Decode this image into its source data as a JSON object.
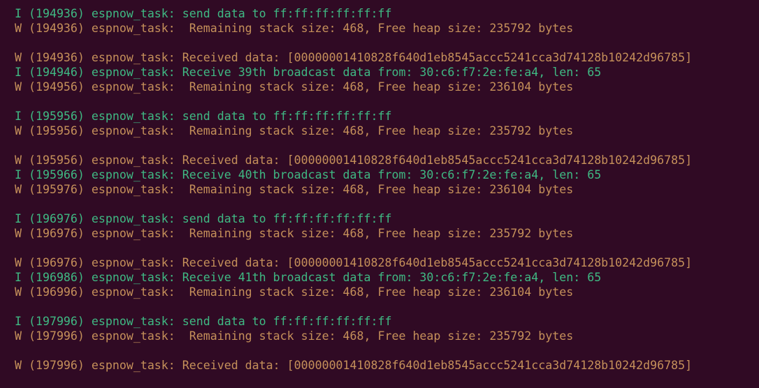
{
  "colors": {
    "background": "#300a24",
    "info": "#3fb983",
    "warning": "#c5905a"
  },
  "terminal": {
    "lines": [
      {
        "level": "I",
        "text": "I (194936) espnow_task: send data to ff:ff:ff:ff:ff:ff"
      },
      {
        "level": "W",
        "text": "W (194936) espnow_task:  Remaining stack size: 468, Free heap size: 235792 bytes"
      },
      {
        "level": "blank",
        "text": ""
      },
      {
        "level": "W",
        "text": "W (194936) espnow_task: Received data: [00000001410828f640d1eb8545accc5241cca3d74128b10242d96785]"
      },
      {
        "level": "I",
        "text": "I (194946) espnow_task: Receive 39th broadcast data from: 30:c6:f7:2e:fe:a4, len: 65"
      },
      {
        "level": "W",
        "text": "W (194956) espnow_task:  Remaining stack size: 468, Free heap size: 236104 bytes"
      },
      {
        "level": "blank",
        "text": ""
      },
      {
        "level": "I",
        "text": "I (195956) espnow_task: send data to ff:ff:ff:ff:ff:ff"
      },
      {
        "level": "W",
        "text": "W (195956) espnow_task:  Remaining stack size: 468, Free heap size: 235792 bytes"
      },
      {
        "level": "blank",
        "text": ""
      },
      {
        "level": "W",
        "text": "W (195956) espnow_task: Received data: [00000001410828f640d1eb8545accc5241cca3d74128b10242d96785]"
      },
      {
        "level": "I",
        "text": "I (195966) espnow_task: Receive 40th broadcast data from: 30:c6:f7:2e:fe:a4, len: 65"
      },
      {
        "level": "W",
        "text": "W (195976) espnow_task:  Remaining stack size: 468, Free heap size: 236104 bytes"
      },
      {
        "level": "blank",
        "text": ""
      },
      {
        "level": "I",
        "text": "I (196976) espnow_task: send data to ff:ff:ff:ff:ff:ff"
      },
      {
        "level": "W",
        "text": "W (196976) espnow_task:  Remaining stack size: 468, Free heap size: 235792 bytes"
      },
      {
        "level": "blank",
        "text": ""
      },
      {
        "level": "W",
        "text": "W (196976) espnow_task: Received data: [00000001410828f640d1eb8545accc5241cca3d74128b10242d96785]"
      },
      {
        "level": "I",
        "text": "I (196986) espnow_task: Receive 41th broadcast data from: 30:c6:f7:2e:fe:a4, len: 65"
      },
      {
        "level": "W",
        "text": "W (196996) espnow_task:  Remaining stack size: 468, Free heap size: 236104 bytes"
      },
      {
        "level": "blank",
        "text": ""
      },
      {
        "level": "I",
        "text": "I (197996) espnow_task: send data to ff:ff:ff:ff:ff:ff"
      },
      {
        "level": "W",
        "text": "W (197996) espnow_task:  Remaining stack size: 468, Free heap size: 235792 bytes"
      },
      {
        "level": "blank",
        "text": ""
      },
      {
        "level": "W",
        "text": "W (197996) espnow_task: Received data: [00000001410828f640d1eb8545accc5241cca3d74128b10242d96785]"
      }
    ]
  }
}
